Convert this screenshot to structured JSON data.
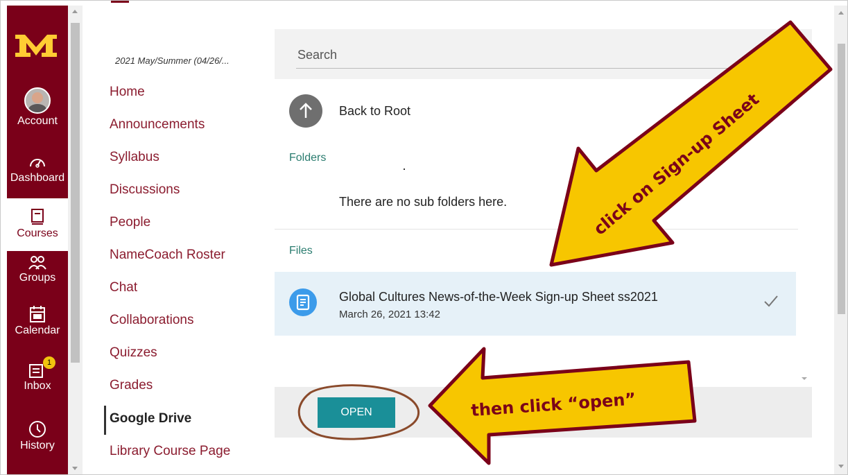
{
  "global_nav": {
    "logo": "M",
    "items": [
      {
        "label": "Account",
        "icon": "avatar"
      },
      {
        "label": "Dashboard",
        "icon": "speedometer-icon"
      },
      {
        "label": "Courses",
        "icon": "book-icon"
      },
      {
        "label": "Groups",
        "icon": "groups-icon"
      },
      {
        "label": "Calendar",
        "icon": "calendar-icon"
      },
      {
        "label": "Inbox",
        "icon": "inbox-icon",
        "badge": "1"
      },
      {
        "label": "History",
        "icon": "clock-icon"
      }
    ],
    "brand_color": "#7a0019",
    "logo_color": "#ffcc33"
  },
  "course_nav": {
    "term": "2021 May/Summer (04/26/...",
    "links": [
      "Home",
      "Announcements",
      "Syllabus",
      "Discussions",
      "People",
      "NameCoach Roster",
      "Chat",
      "Collaborations",
      "Quizzes",
      "Grades",
      "Google Drive",
      "Library Course Page"
    ],
    "active": "Google Drive"
  },
  "drive_dialog": {
    "search_placeholder": "Search",
    "back_label": "Back to Root",
    "folders_label": "Folders",
    "empty_folders": "There are no sub folders here.",
    "files_label": "Files",
    "file": {
      "name": "Global Cultures News-of-the-Week Sign-up Sheet ss2021",
      "date": "March 26, 2021 13:42"
    },
    "open_button": "OPEN"
  },
  "annotations": {
    "arrow_top": "click on Sign-up Sheet",
    "arrow_bottom": "then click “open”",
    "arrow_fill": "#f7c600",
    "arrow_border": "#7a0019"
  }
}
